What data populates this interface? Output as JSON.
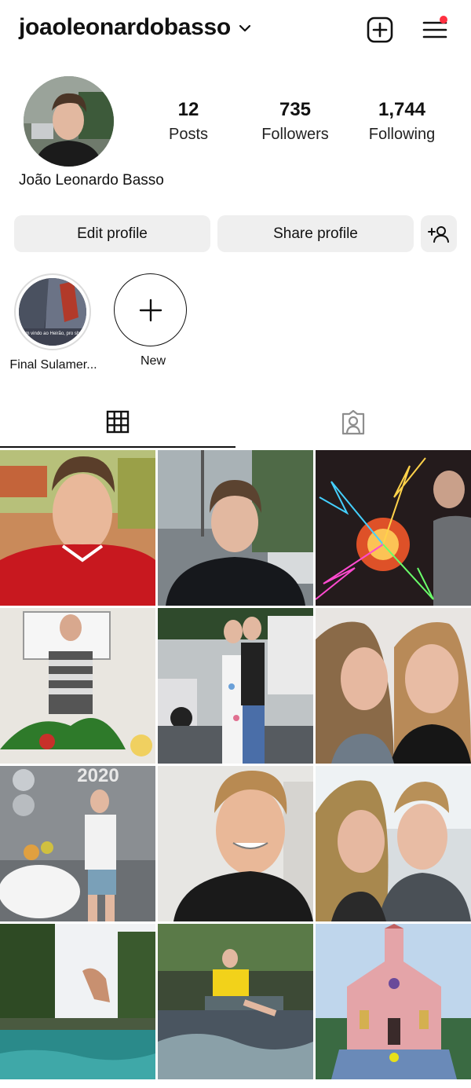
{
  "header": {
    "username": "joaoleonardobasso",
    "chevron_icon": "chevron-down-icon",
    "create_icon": "add-post-icon",
    "menu_icon": "hamburger-menu-icon",
    "notification_dot_color": "#ff3040"
  },
  "profile": {
    "full_name": "João Leonardo Basso",
    "stats": {
      "posts": {
        "value": "12",
        "label": "Posts"
      },
      "followers": {
        "value": "735",
        "label": "Followers"
      },
      "following": {
        "value": "1,744",
        "label": "Following"
      }
    }
  },
  "actions": {
    "edit_label": "Edit profile",
    "share_label": "Share profile",
    "discover_icon": "add-person-icon"
  },
  "highlights": [
    {
      "label": "Final Sulamer...",
      "cover_text": "Bem vindo ao Heirão, pro show"
    },
    {
      "label": "New",
      "icon": "plus-icon"
    }
  ],
  "tabs": [
    {
      "name": "posts-grid",
      "icon": "grid-icon",
      "active": true
    },
    {
      "name": "tagged",
      "icon": "tagged-person-icon",
      "active": false
    }
  ],
  "grid_posts": [
    {
      "description": "portrait in red jersey"
    },
    {
      "description": "portrait in black jacket street"
    },
    {
      "description": "glowing lightning orb"
    },
    {
      "description": "standing by party table"
    },
    {
      "description": "couple on sidewalk"
    },
    {
      "description": "selfie with mother"
    },
    {
      "description": "birthday 2020 party",
      "overlay_text": "2020"
    },
    {
      "description": "smiling close-up"
    },
    {
      "description": "selfie with woman"
    },
    {
      "description": "jump into pool"
    },
    {
      "description": "sitting on waterfall rock"
    },
    {
      "description": "pink church"
    }
  ],
  "colors": {
    "button_bg": "#efefef",
    "text": "#111111",
    "notification": "#ff3040"
  }
}
